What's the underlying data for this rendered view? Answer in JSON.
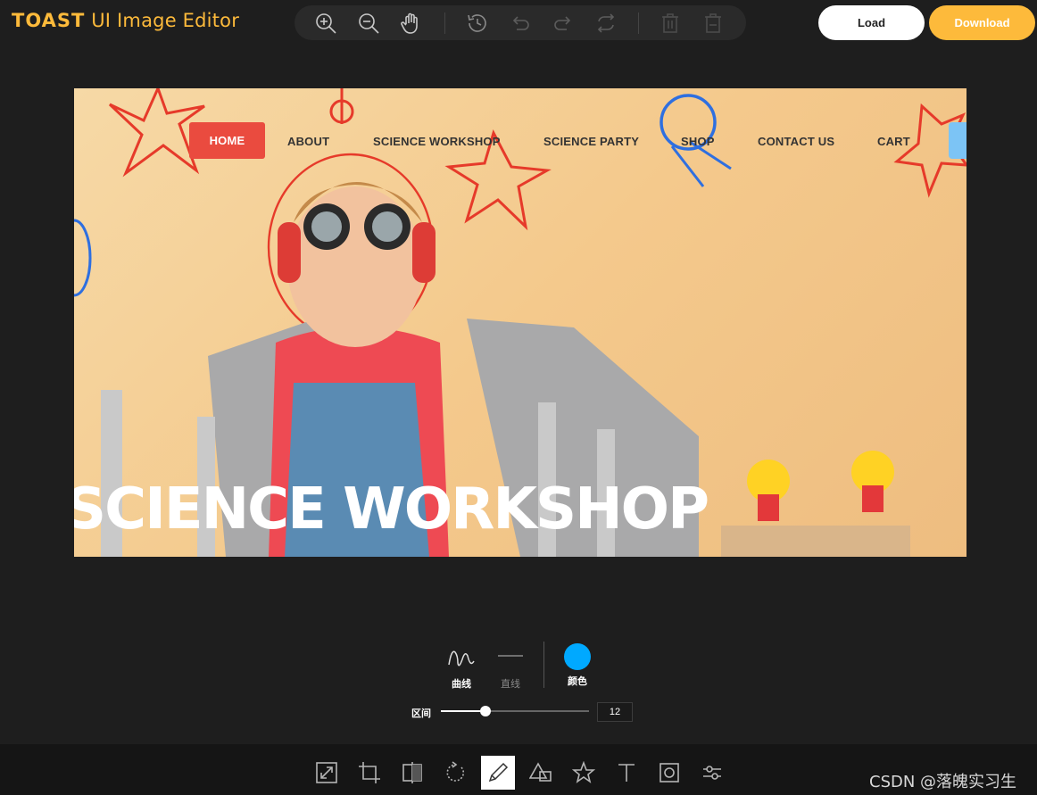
{
  "app": {
    "logo_brand": "TOAST",
    "logo_rest": " UI Image Editor",
    "accent_color": "#fdba3b"
  },
  "top_toolbar": {
    "icons": [
      "zoom-in-icon",
      "zoom-out-icon",
      "hand-icon",
      "history-icon",
      "undo-icon",
      "redo-icon",
      "reset-icon",
      "delete-icon",
      "delete-all-icon"
    ]
  },
  "actions": {
    "load_label": "Load",
    "download_label": "Download"
  },
  "image": {
    "nav": {
      "home": "HOME",
      "about": "ABOUT",
      "science_workshop": "SCIENCE WORKSHOP",
      "science_party": "SCIENCE PARTY",
      "shop": "SHOP",
      "contact": "CONTACT US",
      "cart": "CART"
    },
    "headline": "SCIENCE WORKSHOP"
  },
  "draw_menu": {
    "free_label": "曲线",
    "line_label": "直线",
    "color_label": "颜色",
    "color_value": "#00a9ff",
    "range_label": "区间",
    "range_value": "12",
    "range_fraction": 0.3
  },
  "bottom_menu": {
    "items": [
      "resize-icon",
      "crop-icon",
      "flip-icon",
      "rotate-icon",
      "draw-icon",
      "shape-icon",
      "icon-icon",
      "text-icon",
      "mask-icon",
      "filter-icon"
    ],
    "active": "draw-icon"
  },
  "watermark": "CSDN @落魄实习生"
}
